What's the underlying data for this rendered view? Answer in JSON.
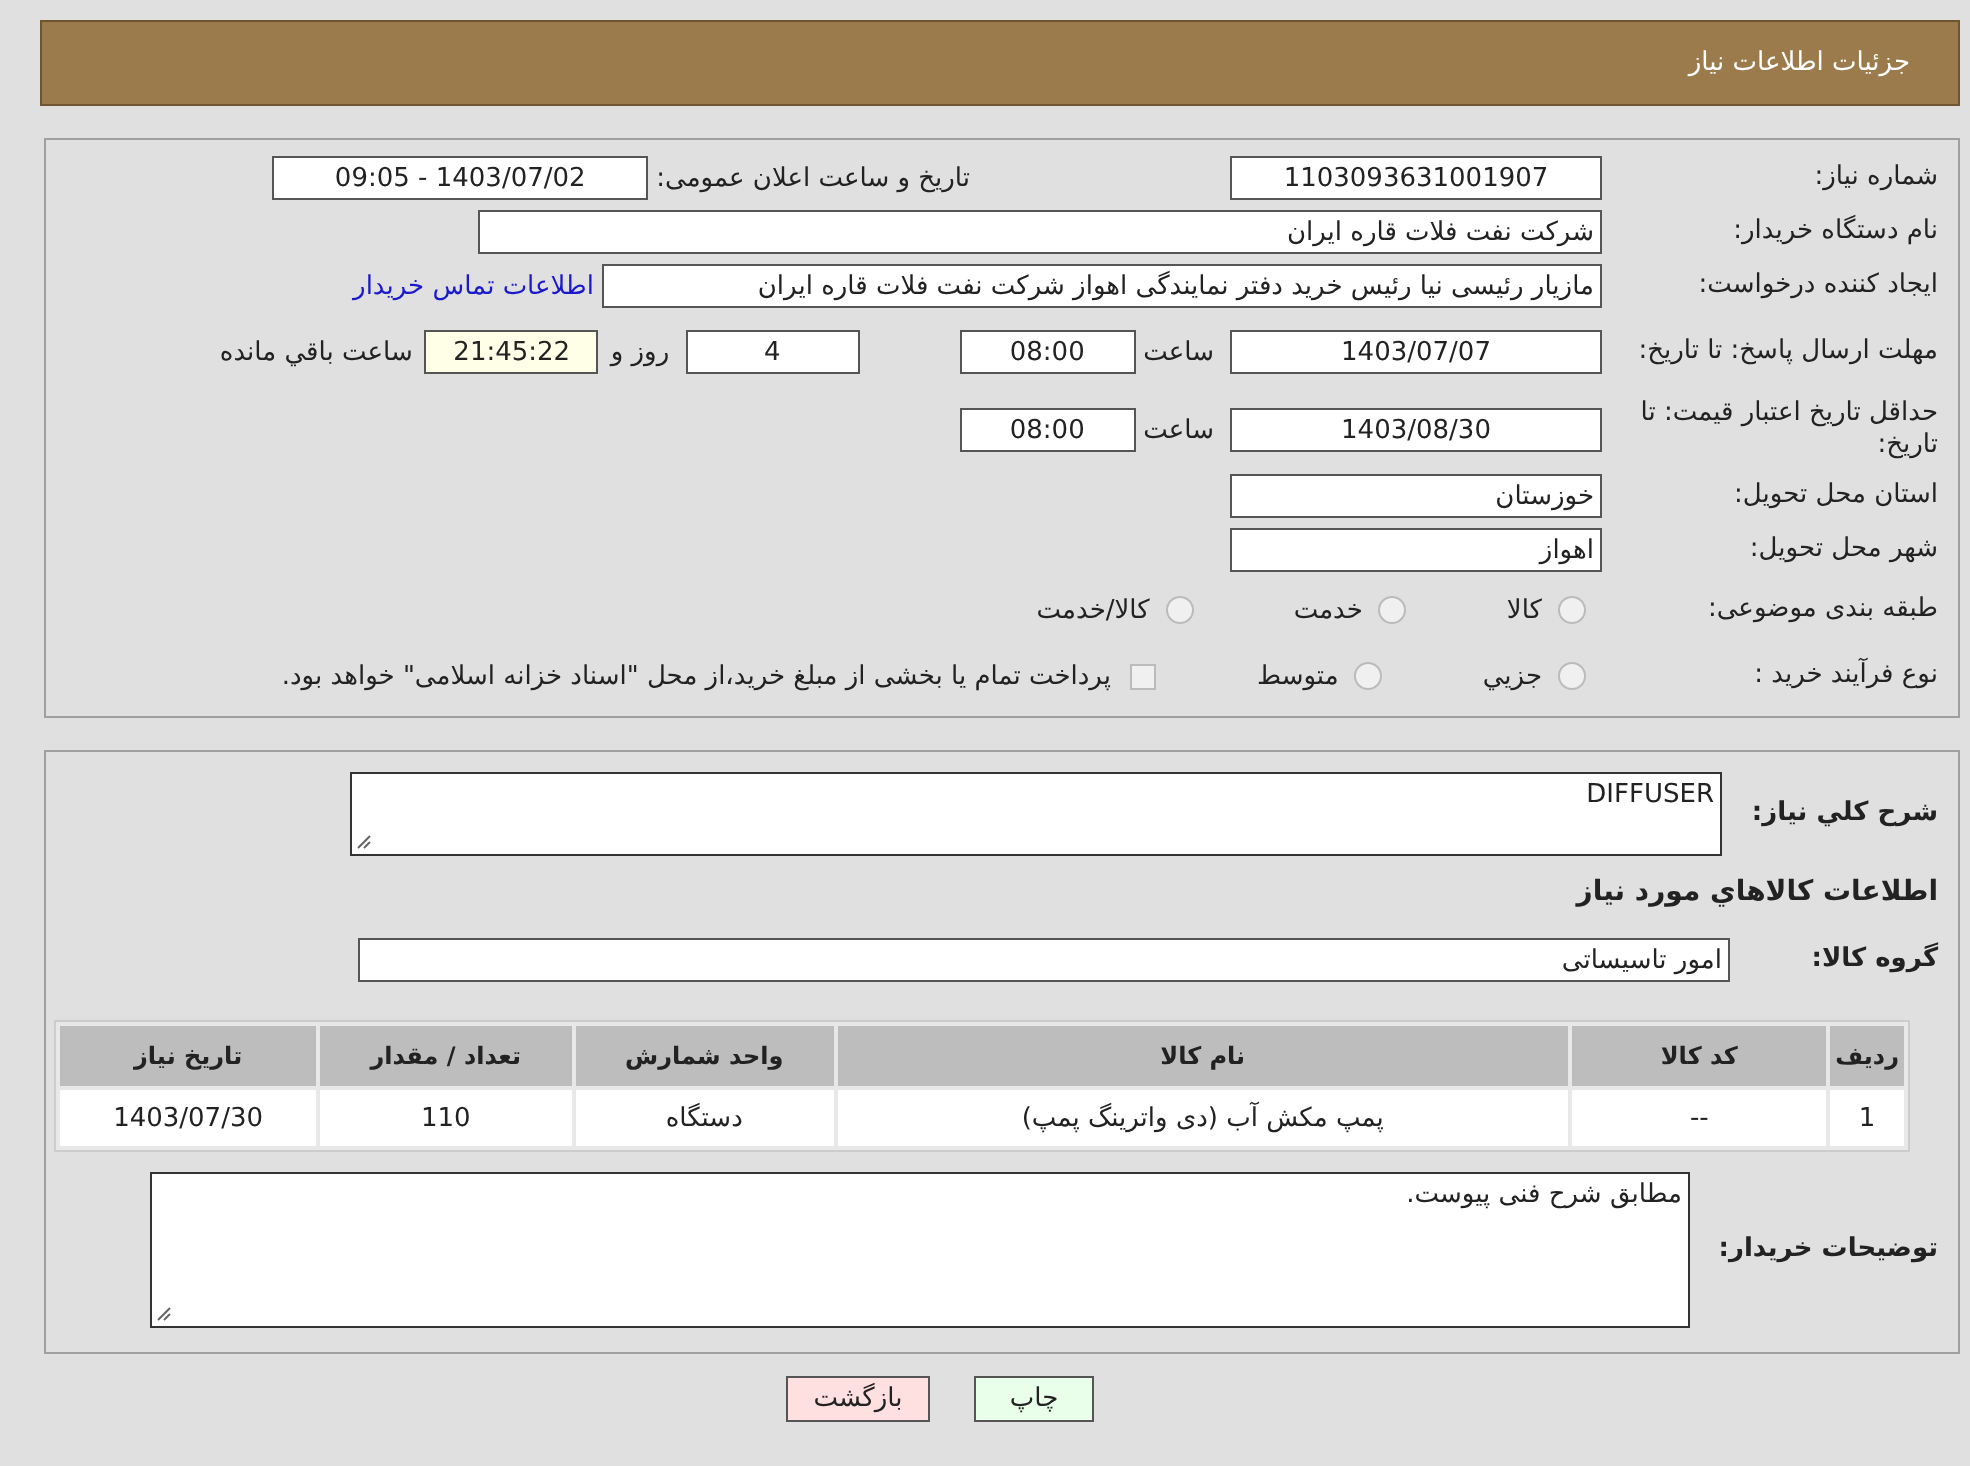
{
  "header": {
    "title": "جزئیات اطلاعات نیاز"
  },
  "rows": [
    {
      "kind": "pair",
      "label": "شماره نیاز:",
      "value": "1103093631001907",
      "label2": "تاریخ و ساعت اعلان عمومی:",
      "value2": "1403/07/02 - 09:05"
    },
    {
      "kind": "wide",
      "label": "نام دستگاه خریدار:",
      "value": "شرکت نفت فلات قاره ایران"
    },
    {
      "kind": "link",
      "label": "ایجاد کننده درخواست:",
      "value": "مازیار رئیسی نیا رئیس خرید دفتر نمایندگی اهواز شرکت نفت فلات قاره ایران",
      "link": "اطلاعات تماس خریدار"
    },
    {
      "kind": "deadline",
      "label": "مهلت ارسال پاسخ: تا تاریخ:",
      "date": "1403/07/07",
      "time_label": "ساعت",
      "time": "08:00",
      "days": "4",
      "days_label": "روز و",
      "remaining": "21:45:22",
      "remaining_label": "ساعت باقي مانده"
    },
    {
      "kind": "datetime",
      "label": "حداقل تاریخ اعتبار قیمت: تا تاریخ:",
      "date": "1403/08/30",
      "time_label": "ساعت",
      "time": "08:00"
    },
    {
      "kind": "short",
      "label": "استان محل تحویل:",
      "value": "خوزستان"
    },
    {
      "kind": "short",
      "label": "شهر محل تحویل:",
      "value": "اهواز"
    },
    {
      "kind": "radios",
      "label": "طبقه بندی موضوعی:",
      "options": [
        {
          "label": "كالا",
          "selected": false
        },
        {
          "label": "خدمت",
          "selected": false
        },
        {
          "label": "كالا/خدمت",
          "selected": false
        }
      ]
    },
    {
      "kind": "purchase",
      "label": "نوع فرآیند خرید :",
      "options": [
        {
          "label": "جزيي",
          "selected": false
        },
        {
          "label": "متوسط",
          "selected": false
        }
      ],
      "note": {
        "checked": false,
        "text": "پرداخت تمام یا بخشی از مبلغ خرید،از محل \"اسناد خزانه اسلامی\" خواهد بود."
      }
    }
  ],
  "description": {
    "label": "شرح كلي نياز:",
    "value": "DIFFUSER"
  },
  "goods_heading": "اطلاعات كالاهاي مورد نياز",
  "goods_group": {
    "label": "گروه كالا:",
    "value": "امور تاسیساتی"
  },
  "table": {
    "columns": [
      "ردیف",
      "کد کالا",
      "نام کالا",
      "واحد شمارش",
      "تعداد / مقدار",
      "تاریخ نیاز"
    ],
    "rows": [
      [
        "1",
        "--",
        "پمپ مکش آب (دی واترینگ پمپ)",
        "دستگاه",
        "110",
        "1403/07/30"
      ]
    ]
  },
  "buyer_notes": {
    "label": "توضیحات خریدار:",
    "value": "مطابق شرح فنی پیوست."
  },
  "buttons": [
    {
      "kind": "print",
      "label": "چاپ"
    },
    {
      "kind": "back",
      "label": "بازگشت"
    }
  ]
}
